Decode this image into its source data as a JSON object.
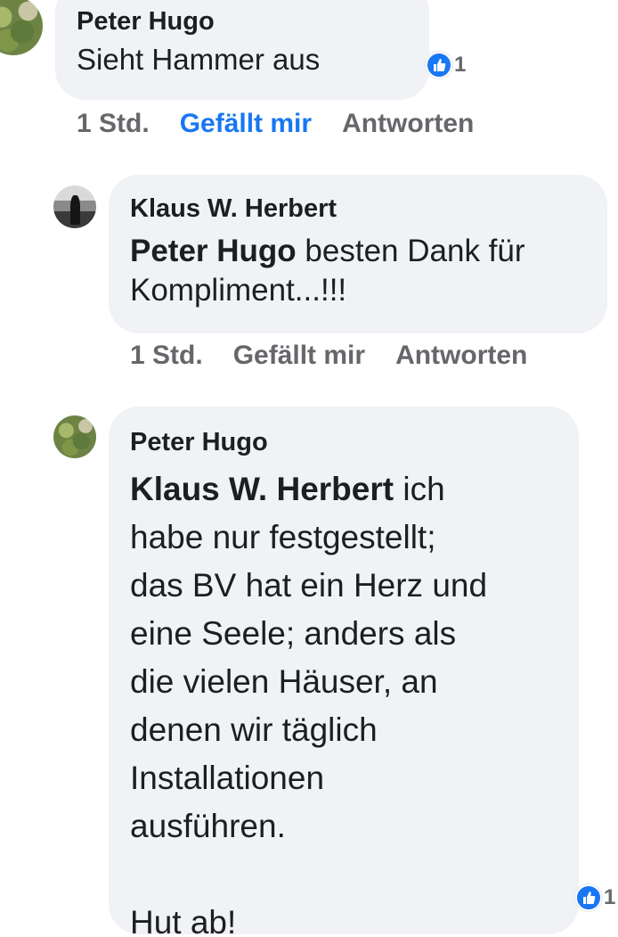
{
  "comments": [
    {
      "author": "Peter Hugo",
      "text": "Sieht Hammer aus",
      "reaction_count": "1",
      "actions": {
        "time": "1 Std.",
        "like": "Gefällt mir",
        "reply": "Antworten"
      }
    },
    {
      "author": "Klaus W. Herbert",
      "mention": "Peter Hugo",
      "text": " besten Dank für Kompliment...!!!",
      "actions": {
        "time": "1 Std.",
        "like": "Gefällt mir",
        "reply": "Antworten"
      }
    },
    {
      "author": "Peter Hugo",
      "mention": "Klaus W. Herbert",
      "text_lines": [
        " ich",
        "habe nur festgestellt;",
        "das BV hat ein Herz und",
        "eine Seele; anders als",
        "die vielen Häuser, an",
        "denen wir täglich",
        "Installationen",
        "ausführen."
      ],
      "closing": "Hut ab!",
      "reaction_count": "1"
    }
  ],
  "colors": {
    "bubble": "#f0f2f5",
    "liked_blue": "#1877f2",
    "meta_gray": "#65676b"
  }
}
